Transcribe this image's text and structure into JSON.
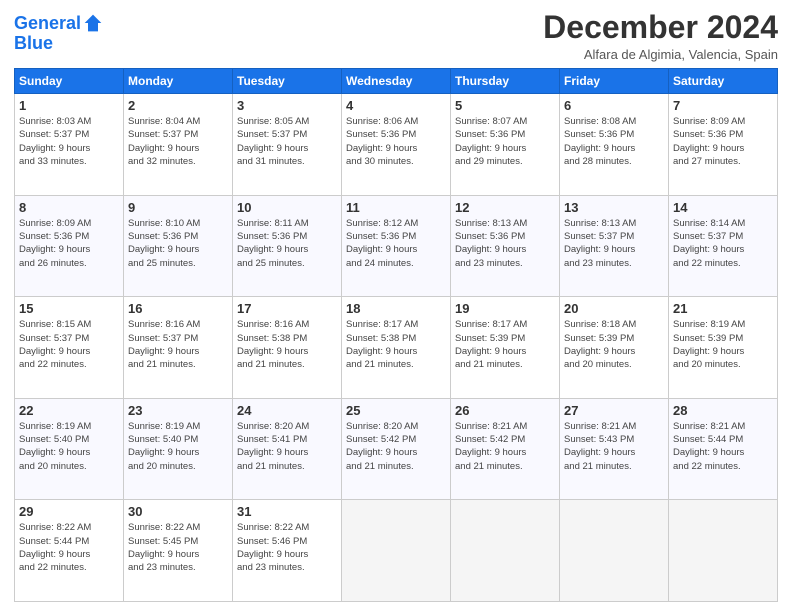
{
  "header": {
    "logo_line1": "General",
    "logo_line2": "Blue",
    "month": "December 2024",
    "location": "Alfara de Algimia, Valencia, Spain"
  },
  "days_of_week": [
    "Sunday",
    "Monday",
    "Tuesday",
    "Wednesday",
    "Thursday",
    "Friday",
    "Saturday"
  ],
  "weeks": [
    [
      {
        "day": "1",
        "info": "Sunrise: 8:03 AM\nSunset: 5:37 PM\nDaylight: 9 hours\nand 33 minutes."
      },
      {
        "day": "2",
        "info": "Sunrise: 8:04 AM\nSunset: 5:37 PM\nDaylight: 9 hours\nand 32 minutes."
      },
      {
        "day": "3",
        "info": "Sunrise: 8:05 AM\nSunset: 5:37 PM\nDaylight: 9 hours\nand 31 minutes."
      },
      {
        "day": "4",
        "info": "Sunrise: 8:06 AM\nSunset: 5:36 PM\nDaylight: 9 hours\nand 30 minutes."
      },
      {
        "day": "5",
        "info": "Sunrise: 8:07 AM\nSunset: 5:36 PM\nDaylight: 9 hours\nand 29 minutes."
      },
      {
        "day": "6",
        "info": "Sunrise: 8:08 AM\nSunset: 5:36 PM\nDaylight: 9 hours\nand 28 minutes."
      },
      {
        "day": "7",
        "info": "Sunrise: 8:09 AM\nSunset: 5:36 PM\nDaylight: 9 hours\nand 27 minutes."
      }
    ],
    [
      {
        "day": "8",
        "info": "Sunrise: 8:09 AM\nSunset: 5:36 PM\nDaylight: 9 hours\nand 26 minutes."
      },
      {
        "day": "9",
        "info": "Sunrise: 8:10 AM\nSunset: 5:36 PM\nDaylight: 9 hours\nand 25 minutes."
      },
      {
        "day": "10",
        "info": "Sunrise: 8:11 AM\nSunset: 5:36 PM\nDaylight: 9 hours\nand 25 minutes."
      },
      {
        "day": "11",
        "info": "Sunrise: 8:12 AM\nSunset: 5:36 PM\nDaylight: 9 hours\nand 24 minutes."
      },
      {
        "day": "12",
        "info": "Sunrise: 8:13 AM\nSunset: 5:36 PM\nDaylight: 9 hours\nand 23 minutes."
      },
      {
        "day": "13",
        "info": "Sunrise: 8:13 AM\nSunset: 5:37 PM\nDaylight: 9 hours\nand 23 minutes."
      },
      {
        "day": "14",
        "info": "Sunrise: 8:14 AM\nSunset: 5:37 PM\nDaylight: 9 hours\nand 22 minutes."
      }
    ],
    [
      {
        "day": "15",
        "info": "Sunrise: 8:15 AM\nSunset: 5:37 PM\nDaylight: 9 hours\nand 22 minutes."
      },
      {
        "day": "16",
        "info": "Sunrise: 8:16 AM\nSunset: 5:37 PM\nDaylight: 9 hours\nand 21 minutes."
      },
      {
        "day": "17",
        "info": "Sunrise: 8:16 AM\nSunset: 5:38 PM\nDaylight: 9 hours\nand 21 minutes."
      },
      {
        "day": "18",
        "info": "Sunrise: 8:17 AM\nSunset: 5:38 PM\nDaylight: 9 hours\nand 21 minutes."
      },
      {
        "day": "19",
        "info": "Sunrise: 8:17 AM\nSunset: 5:39 PM\nDaylight: 9 hours\nand 21 minutes."
      },
      {
        "day": "20",
        "info": "Sunrise: 8:18 AM\nSunset: 5:39 PM\nDaylight: 9 hours\nand 20 minutes."
      },
      {
        "day": "21",
        "info": "Sunrise: 8:19 AM\nSunset: 5:39 PM\nDaylight: 9 hours\nand 20 minutes."
      }
    ],
    [
      {
        "day": "22",
        "info": "Sunrise: 8:19 AM\nSunset: 5:40 PM\nDaylight: 9 hours\nand 20 minutes."
      },
      {
        "day": "23",
        "info": "Sunrise: 8:19 AM\nSunset: 5:40 PM\nDaylight: 9 hours\nand 20 minutes."
      },
      {
        "day": "24",
        "info": "Sunrise: 8:20 AM\nSunset: 5:41 PM\nDaylight: 9 hours\nand 21 minutes."
      },
      {
        "day": "25",
        "info": "Sunrise: 8:20 AM\nSunset: 5:42 PM\nDaylight: 9 hours\nand 21 minutes."
      },
      {
        "day": "26",
        "info": "Sunrise: 8:21 AM\nSunset: 5:42 PM\nDaylight: 9 hours\nand 21 minutes."
      },
      {
        "day": "27",
        "info": "Sunrise: 8:21 AM\nSunset: 5:43 PM\nDaylight: 9 hours\nand 21 minutes."
      },
      {
        "day": "28",
        "info": "Sunrise: 8:21 AM\nSunset: 5:44 PM\nDaylight: 9 hours\nand 22 minutes."
      }
    ],
    [
      {
        "day": "29",
        "info": "Sunrise: 8:22 AM\nSunset: 5:44 PM\nDaylight: 9 hours\nand 22 minutes."
      },
      {
        "day": "30",
        "info": "Sunrise: 8:22 AM\nSunset: 5:45 PM\nDaylight: 9 hours\nand 23 minutes."
      },
      {
        "day": "31",
        "info": "Sunrise: 8:22 AM\nSunset: 5:46 PM\nDaylight: 9 hours\nand 23 minutes."
      },
      null,
      null,
      null,
      null
    ]
  ]
}
